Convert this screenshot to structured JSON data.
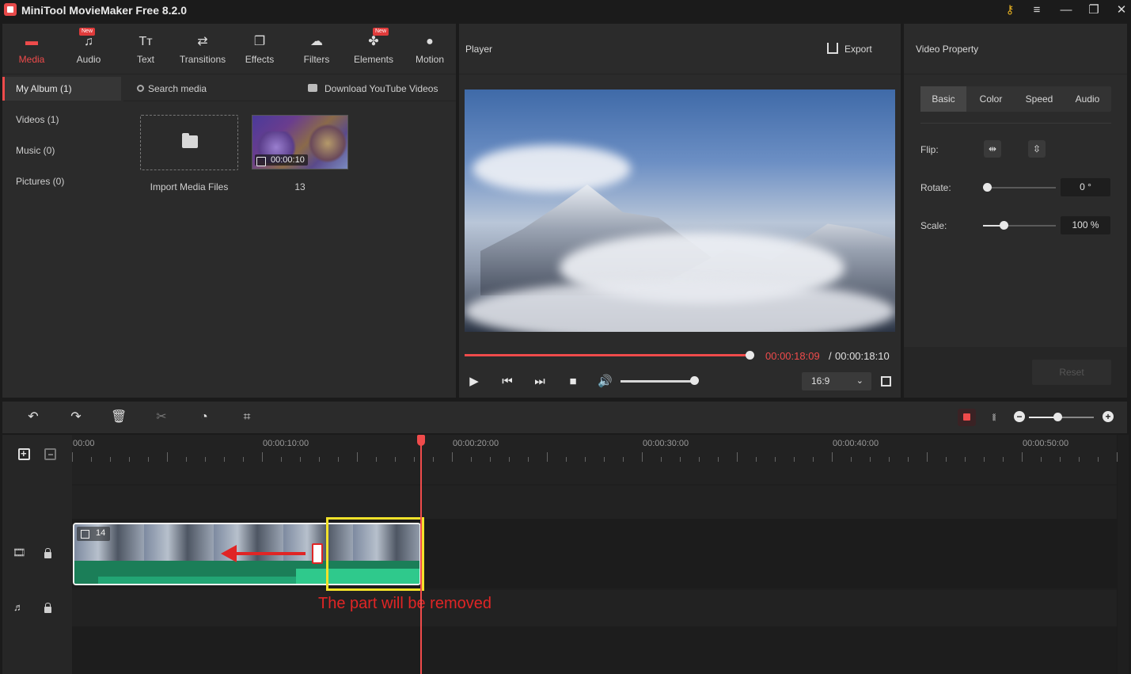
{
  "app": {
    "title": "MiniTool MovieMaker Free 8.2.0"
  },
  "window_controls": [
    {
      "name": "key-icon",
      "glyph": "⚷"
    },
    {
      "name": "menu-icon",
      "glyph": "≡"
    },
    {
      "name": "minimize-icon",
      "glyph": "—"
    },
    {
      "name": "maximize-icon",
      "glyph": "❐"
    },
    {
      "name": "close-icon",
      "glyph": "✕"
    }
  ],
  "toolbar": {
    "tabs": [
      {
        "label": "Media",
        "icon": "folder-icon",
        "glyph": "▬",
        "active": true,
        "badge": ""
      },
      {
        "label": "Audio",
        "icon": "music-icon",
        "glyph": "♫",
        "active": false,
        "badge": "New"
      },
      {
        "label": "Text",
        "icon": "text-icon",
        "glyph": "Tт",
        "active": false,
        "badge": ""
      },
      {
        "label": "Transitions",
        "icon": "transitions-icon",
        "glyph": "⇄",
        "active": false,
        "badge": ""
      },
      {
        "label": "Effects",
        "icon": "effects-icon",
        "glyph": "❐",
        "active": false,
        "badge": ""
      },
      {
        "label": "Filters",
        "icon": "filters-icon",
        "glyph": "☁",
        "active": false,
        "badge": ""
      },
      {
        "label": "Elements",
        "icon": "elements-icon",
        "glyph": "✤",
        "active": false,
        "badge": "New"
      },
      {
        "label": "Motion",
        "icon": "motion-icon",
        "glyph": "●",
        "active": false,
        "badge": ""
      }
    ]
  },
  "sidebar": {
    "items": [
      {
        "label": "My Album (1)",
        "active": true
      },
      {
        "label": "Videos (1)",
        "active": false
      },
      {
        "label": "Music (0)",
        "active": false
      },
      {
        "label": "Pictures (0)",
        "active": false
      }
    ]
  },
  "media": {
    "search_label": "Search media",
    "youtube_label": "Download YouTube Videos",
    "import_label": "Import Media Files",
    "clip": {
      "name": "13",
      "duration": "00:00:10"
    }
  },
  "player": {
    "title": "Player",
    "export_label": "Export",
    "progress": 0.99,
    "time_current": "00:00:18:09",
    "time_separator": "/",
    "time_total": "00:00:18:10",
    "volume": 0.9,
    "aspect_ratio": "16:9"
  },
  "property": {
    "title": "Video Property",
    "tabs": [
      {
        "label": "Basic",
        "active": true
      },
      {
        "label": "Color",
        "active": false
      },
      {
        "label": "Speed",
        "active": false
      },
      {
        "label": "Audio",
        "active": false
      }
    ],
    "flip_label": "Flip:",
    "rotate_label": "Rotate:",
    "rotate_value": "0 °",
    "scale_label": "Scale:",
    "scale_value": "100 %",
    "reset_label": "Reset"
  },
  "timeline": {
    "tools": [
      {
        "name": "undo-icon",
        "glyph": "↶"
      },
      {
        "name": "redo-icon",
        "glyph": "↷"
      },
      {
        "name": "delete-icon",
        "glyph": "🗑"
      },
      {
        "name": "split-icon",
        "glyph": "✂"
      },
      {
        "name": "speed-icon",
        "glyph": "◔"
      },
      {
        "name": "crop-icon",
        "glyph": "⌗"
      }
    ],
    "ruler_labels": [
      "00:00",
      "00:00:10:00",
      "00:00:20:00",
      "00:00:30:00",
      "00:00:40:00",
      "00:00:50:00"
    ],
    "video_clip_label": "14",
    "annotation": "The part will be removed",
    "zoom": 0.44
  },
  "colors": {
    "accent": "#ef4b4b",
    "highlight_box": "#f2e22a",
    "annotation": "#e02525",
    "waveform": "#2fc98c"
  }
}
